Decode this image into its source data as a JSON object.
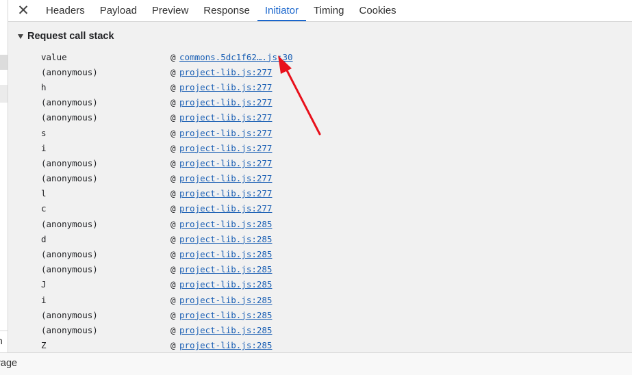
{
  "tabs": [
    {
      "label": "Headers",
      "active": false
    },
    {
      "label": "Payload",
      "active": false
    },
    {
      "label": "Preview",
      "active": false
    },
    {
      "label": "Response",
      "active": false
    },
    {
      "label": "Initiator",
      "active": true
    },
    {
      "label": "Timing",
      "active": false
    },
    {
      "label": "Cookies",
      "active": false
    }
  ],
  "icons": {
    "close": "close-icon",
    "collapse": "triangle-down-icon"
  },
  "section": {
    "title": "Request call stack"
  },
  "call_stack": [
    {
      "fn": "value",
      "loc": "commons.5dc1f62….js:30"
    },
    {
      "fn": "(anonymous)",
      "loc": "project-lib.js:277"
    },
    {
      "fn": "h",
      "loc": "project-lib.js:277"
    },
    {
      "fn": "(anonymous)",
      "loc": "project-lib.js:277"
    },
    {
      "fn": "(anonymous)",
      "loc": "project-lib.js:277"
    },
    {
      "fn": "s",
      "loc": "project-lib.js:277"
    },
    {
      "fn": "i",
      "loc": "project-lib.js:277"
    },
    {
      "fn": "(anonymous)",
      "loc": "project-lib.js:277"
    },
    {
      "fn": "(anonymous)",
      "loc": "project-lib.js:277"
    },
    {
      "fn": "l",
      "loc": "project-lib.js:277"
    },
    {
      "fn": "c",
      "loc": "project-lib.js:277"
    },
    {
      "fn": "(anonymous)",
      "loc": "project-lib.js:285"
    },
    {
      "fn": "d",
      "loc": "project-lib.js:285"
    },
    {
      "fn": "(anonymous)",
      "loc": "project-lib.js:285"
    },
    {
      "fn": "(anonymous)",
      "loc": "project-lib.js:285"
    },
    {
      "fn": "J",
      "loc": "project-lib.js:285"
    },
    {
      "fn": "i",
      "loc": "project-lib.js:285"
    },
    {
      "fn": "(anonymous)",
      "loc": "project-lib.js:285"
    },
    {
      "fn": "(anonymous)",
      "loc": "project-lib.js:285"
    },
    {
      "fn": "Z",
      "loc": "project-lib.js:285"
    }
  ],
  "at_symbol": "@",
  "left_panel": {
    "cut_text": "n"
  },
  "bottom_drawer": {
    "cut_text": "erage"
  },
  "colors": {
    "accent": "#1a66cc",
    "link": "#1a5fb4",
    "annotation_arrow": "#e8101b"
  }
}
